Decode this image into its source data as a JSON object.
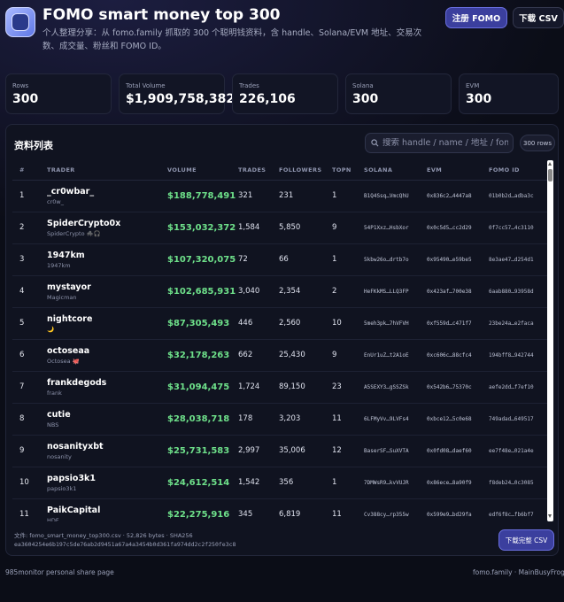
{
  "header": {
    "title": "FOMO smart money top 300",
    "subtitle": "个人整理分享：从 fomo.family 抓取的 300 个聪明钱资料，含 handle、Solana/EVM 地址、交易次数、成交量、粉丝和 FOMO ID。",
    "register_label": "注册 FOMO",
    "download_label": "下载 CSV",
    "logo_icon": "app-logo-icon"
  },
  "stats": [
    {
      "label": "Rows",
      "value": "300"
    },
    {
      "label": "Total Volume",
      "value": "$1,909,758,382"
    },
    {
      "label": "Trades",
      "value": "226,106"
    },
    {
      "label": "Solana",
      "value": "300"
    },
    {
      "label": "EVM",
      "value": "300"
    }
  ],
  "panel": {
    "title": "资料列表",
    "search_placeholder": "搜索 handle / name / 地址 / fomo id",
    "rows_badge": "300 rows"
  },
  "table": {
    "columns": [
      "#",
      "TRADER",
      "VOLUME",
      "TRADES",
      "FOLLOWERS",
      "TOPN",
      "SOLANA",
      "EVM",
      "FOMO ID"
    ],
    "rows": [
      {
        "idx": "1",
        "handle": "_cr0wbar_",
        "name": "cr0w_",
        "volume": "$188,778,491",
        "trades": "321",
        "followers": "231",
        "topn": "1",
        "solana": "B1Q4Ssq…VmcQhU",
        "evm": "0x836c2…4447a8",
        "fomo": "01b0b2d…adba3c"
      },
      {
        "idx": "2",
        "handle": "SpiderCrypto0x",
        "name": "SpiderCrypto 🕷️🎧",
        "volume": "$153,032,372",
        "trades": "1,584",
        "followers": "5,850",
        "topn": "9",
        "solana": "54P1Xxz…HsbXor",
        "evm": "0x0c5d5…cc2d29",
        "fomo": "0f7cc57…4c3110"
      },
      {
        "idx": "3",
        "handle": "1947km",
        "name": "1947km",
        "volume": "$107,320,075",
        "trades": "72",
        "followers": "66",
        "topn": "1",
        "solana": "5kbw26o…drtb7o",
        "evm": "0x95490…e59be5",
        "fomo": "8e3ae47…d254d1"
      },
      {
        "idx": "4",
        "handle": "mystayor",
        "name": "Magicman",
        "volume": "$102,685,931",
        "trades": "3,040",
        "followers": "2,354",
        "topn": "2",
        "solana": "HeFKkMS…LLQ3FP",
        "evm": "0x423af…700e38",
        "fomo": "6aab880…93958d"
      },
      {
        "idx": "5",
        "handle": "nightcore",
        "name": "🌙",
        "volume": "$87,305,493",
        "trades": "446",
        "followers": "2,560",
        "topn": "10",
        "solana": "5meh3pk…7hVFVH",
        "evm": "0xf559d…c471f7",
        "fomo": "23be24a…e2faca"
      },
      {
        "idx": "6",
        "handle": "octoseaa",
        "name": "Octosea 🐙",
        "volume": "$32,178,263",
        "trades": "662",
        "followers": "25,430",
        "topn": "9",
        "solana": "EnUr1uZ…t2A1oE",
        "evm": "0xc606c…88cfc4",
        "fomo": "194bff8…942744"
      },
      {
        "idx": "7",
        "handle": "frankdegods",
        "name": "frank",
        "volume": "$31,094,475",
        "trades": "1,724",
        "followers": "89,150",
        "topn": "23",
        "solana": "A5SEXY3…gSSZSk",
        "evm": "0x542b6…75370c",
        "fomo": "aefe2dd…f7ef10"
      },
      {
        "idx": "8",
        "handle": "cutie",
        "name": "NBS",
        "volume": "$28,038,718",
        "trades": "178",
        "followers": "3,203",
        "topn": "11",
        "solana": "6LFMyVv…9LVFs4",
        "evm": "0xbce12…5c0e68",
        "fomo": "749adad…649517"
      },
      {
        "idx": "9",
        "handle": "nosanityxbt",
        "name": "nosanity",
        "volume": "$25,731,583",
        "trades": "2,997",
        "followers": "35,006",
        "topn": "12",
        "solana": "BaserSF…SuXVTA",
        "evm": "0x0fd08…daef60",
        "fomo": "ee7f48e…021a4e"
      },
      {
        "idx": "10",
        "handle": "papsio3k1",
        "name": "papsio3k1",
        "volume": "$24,612,514",
        "trades": "1,542",
        "followers": "356",
        "topn": "1",
        "solana": "7DMWsR9…kvVUJR",
        "evm": "0x86ece…8a90f9",
        "fomo": "f8deb24…0c3085"
      },
      {
        "idx": "11",
        "handle": "PaikCapital",
        "name": "HDF",
        "volume": "$22,275,916",
        "trades": "345",
        "followers": "6,819",
        "topn": "11",
        "solana": "Cv388cy…rp355w",
        "evm": "0x599e9…bd29fa",
        "fomo": "edf6f8c…fb6bf7"
      }
    ]
  },
  "fileinfo": {
    "line1": "文件: fomo_smart_money_top300.csv · 52,826 bytes · SHA256",
    "line2": "ea3604254e6b197c5de76ab2d9451a67a4a3454b0d361fa974dd2c2f250fe3c8"
  },
  "full_download_label": "下载完整 CSV",
  "footer": {
    "left": "985monitor personal share page",
    "right": "fomo.family · MainBusyFrog"
  }
}
